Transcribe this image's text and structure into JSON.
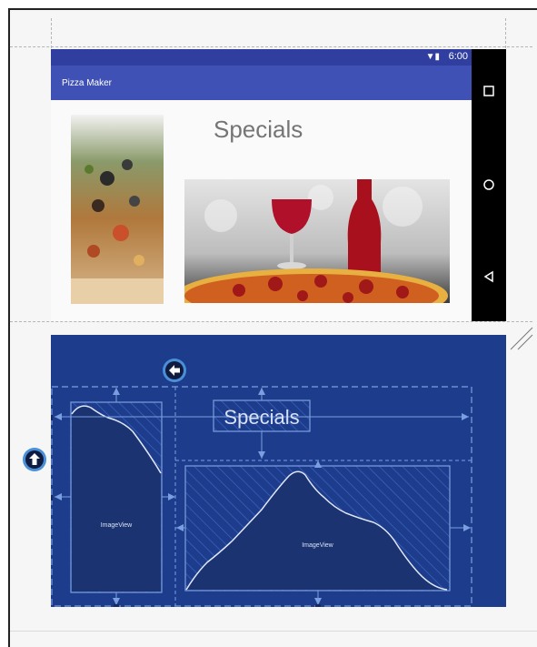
{
  "status_bar": {
    "time": "6:00",
    "icons": [
      "wifi-icon",
      "battery-icon"
    ]
  },
  "app_bar": {
    "title": "Pizza Maker"
  },
  "design": {
    "heading": "Specials"
  },
  "blueprint": {
    "heading": "Specials",
    "image_left_label": "ImageView",
    "image_right_label": "ImageView"
  },
  "nav_buttons": [
    "recents-icon",
    "home-icon",
    "back-icon"
  ],
  "badges": [
    "arrow-left-icon",
    "arrow-up-icon"
  ],
  "colors": {
    "status_bar": "#303f9f",
    "app_bar": "#3f51b5",
    "blueprint_bg": "#1e3c8c",
    "blueprint_line": "#7a9fe0",
    "badge": "#4a90d9"
  }
}
